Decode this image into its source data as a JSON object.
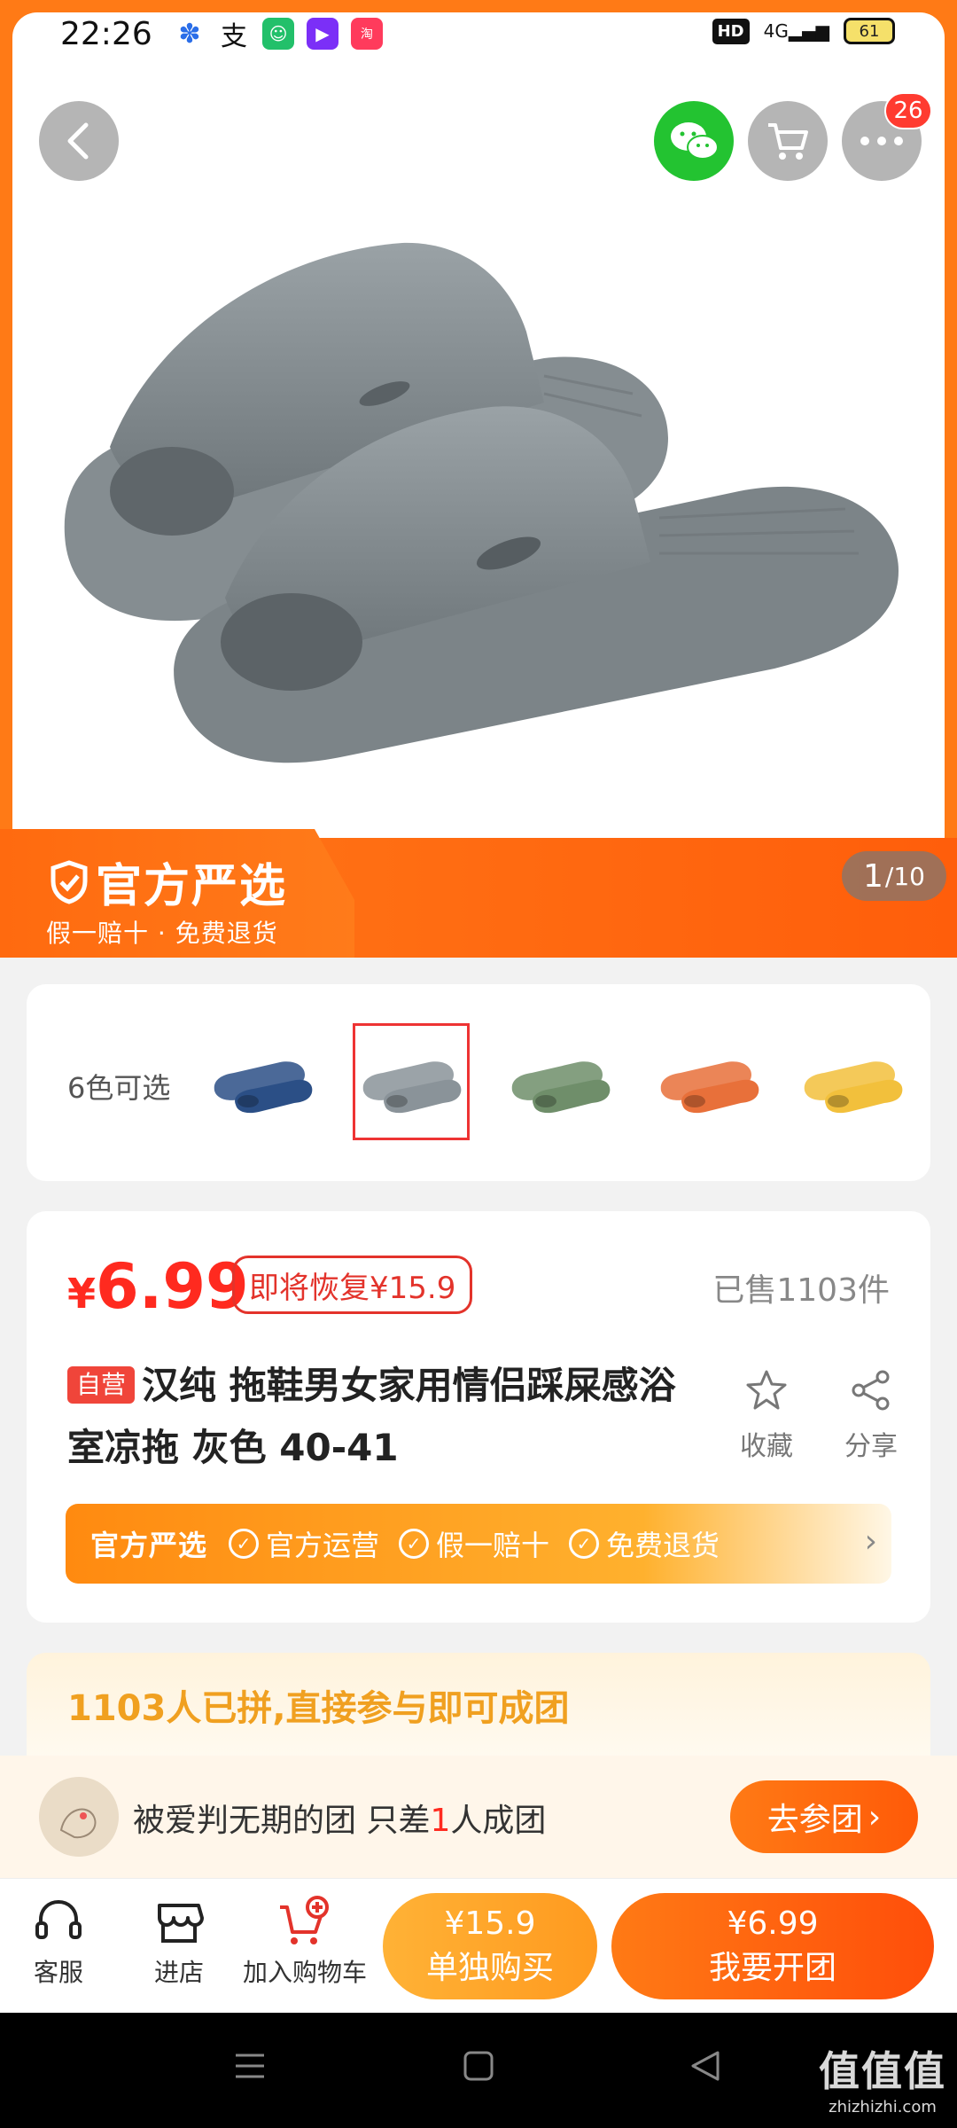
{
  "status_bar": {
    "time": "22:26",
    "battery": "61",
    "hd": "HD",
    "signal": "4G"
  },
  "header": {
    "cart_badge": "26"
  },
  "hero": {
    "strip_title": "官方严选",
    "strip_subtitle": "假一赔十 · 免费退货",
    "pager_current": "1",
    "pager_total": "/10"
  },
  "colors": {
    "label": "6色可选",
    "swatches": [
      "#2b4f86",
      "#8a9399",
      "#6f8e6a",
      "#e8703a",
      "#f2c03c"
    ],
    "selected_index": 1
  },
  "product": {
    "price_currency": "¥",
    "price": "6.99",
    "restore_label": "即将恢复¥15.9",
    "sold": "已售1103件",
    "self_tag": "自营",
    "title": "汉纯 拖鞋男女家用情侣踩屎感浴室凉拖 灰色 40-41",
    "fav_label": "收藏",
    "share_label": "分享"
  },
  "guarantee": {
    "title": "官方严选",
    "items": [
      "官方运营",
      "假一赔十",
      "免费退货"
    ]
  },
  "group": {
    "header": "1103人已拼,直接参与即可成团",
    "team_prefix": "被爱判无期的团 只差",
    "team_count": "1",
    "team_suffix": "人成团",
    "join_label": "去参团"
  },
  "actions": {
    "service": "客服",
    "store": "进店",
    "add_cart": "加入购物车",
    "single_price": "¥15.9",
    "single_label": "单独购买",
    "group_price": "¥6.99",
    "group_label": "我要开团"
  },
  "watermark": {
    "big": "值值值",
    "small": "zhizhizhi.com"
  }
}
